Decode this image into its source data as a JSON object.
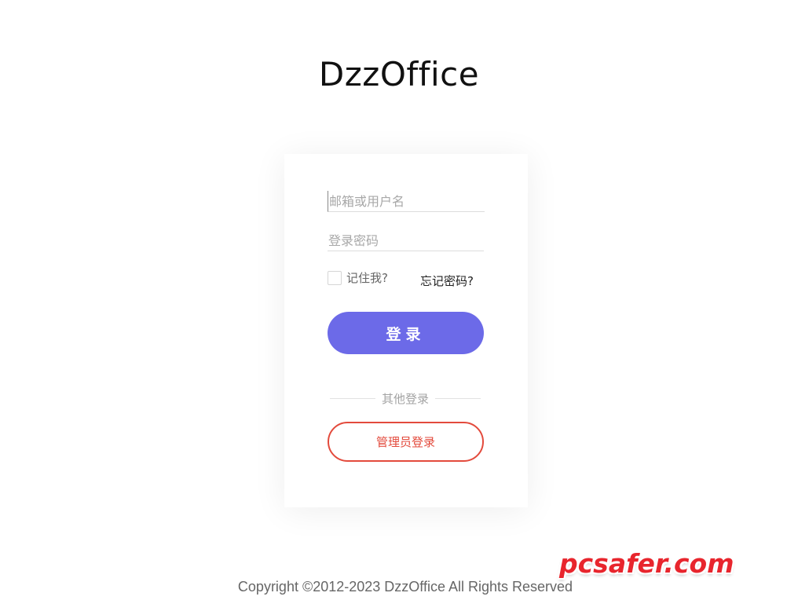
{
  "header": {
    "title": "DzzOffice"
  },
  "login_form": {
    "username_placeholder": "邮箱或用户名",
    "password_placeholder": "登录密码",
    "remember_label": "记住我?",
    "remember_checked": false,
    "forgot_label": "忘记密码?",
    "submit_label": "登录",
    "other_login_label": "其他登录",
    "admin_login_label": "管理员登录"
  },
  "colors": {
    "primary_button": "#6c6ae8",
    "admin_accent": "#e34a3c",
    "watermark": "#e8252d"
  },
  "watermark": {
    "text": "pcsafer.com"
  },
  "footer": {
    "copyright": "Copyright ©2012-2023 DzzOffice All Rights Reserved"
  }
}
